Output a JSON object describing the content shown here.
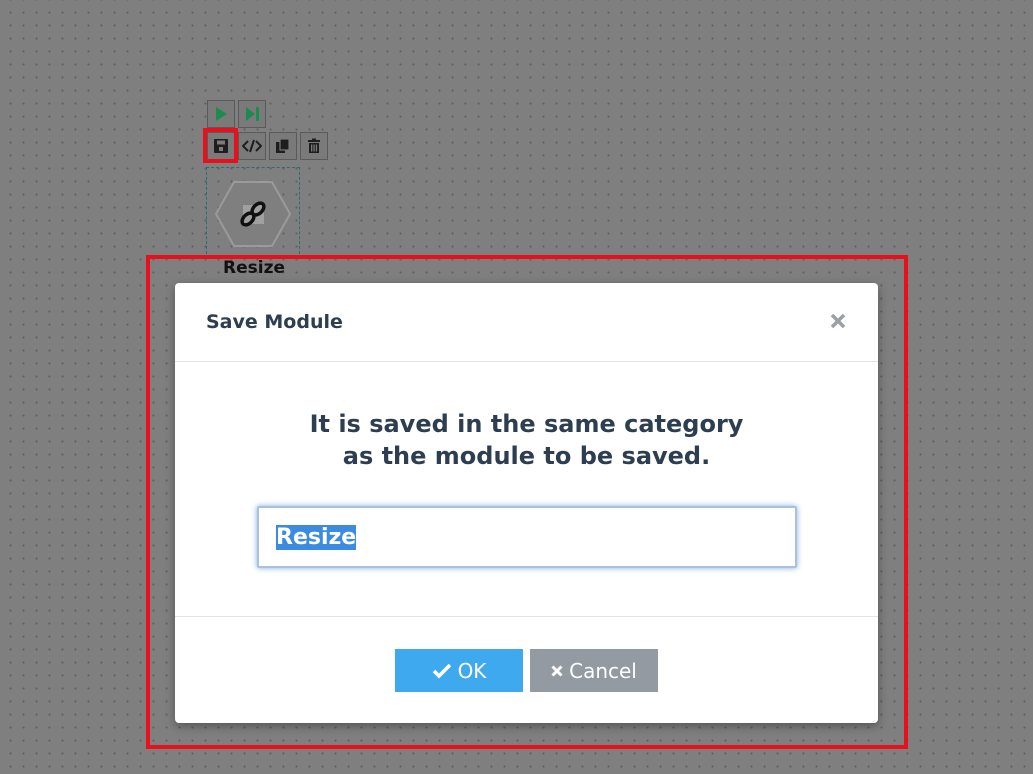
{
  "canvas": {
    "toolbar": {
      "run_icon": "play-icon",
      "step_icon": "step-forward-icon",
      "save_icon": "save-icon",
      "code_icon": "code-icon",
      "copy_icon": "copy-icon",
      "delete_icon": "trash-icon"
    },
    "node": {
      "label": "Resize",
      "icon": "link-icon"
    }
  },
  "dialog": {
    "title": "Save Module",
    "close_icon": "close-icon",
    "message_line1": "It is saved in the same category",
    "message_line2": "as the module to be saved.",
    "input_value": "Resize",
    "ok_label": "OK",
    "cancel_label": "Cancel"
  },
  "colors": {
    "highlight": "#e8101a",
    "ok_button": "#3fa9f0",
    "cancel_button": "#939aa2",
    "toolbar_icon_green": "#1a8c4e"
  }
}
